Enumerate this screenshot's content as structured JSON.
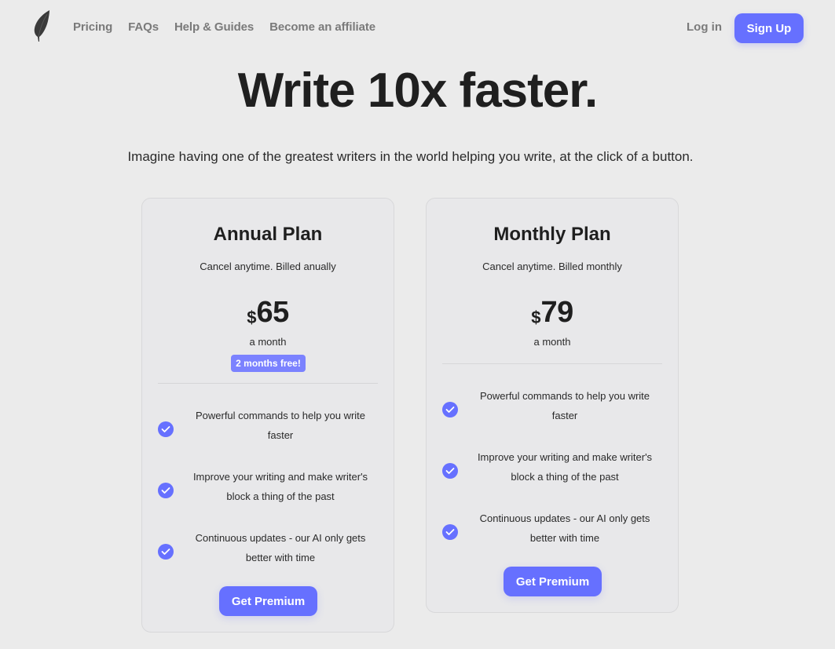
{
  "nav": {
    "logo": "feather-icon",
    "links": [
      "Pricing",
      "FAQs",
      "Help & Guides",
      "Become an affiliate"
    ],
    "login_label": "Log in",
    "signup_label": "Sign Up"
  },
  "hero": {
    "title": "Write 10x faster.",
    "subtitle": "Imagine having one of the greatest writers in the world helping you write, at the click of a button."
  },
  "colors": {
    "accent": "#6670ff",
    "badge": "#7b82ff",
    "background": "#ebebeb",
    "card": "#e8e8ea"
  },
  "plans": [
    {
      "title": "Annual Plan",
      "description": "Cancel anytime. Billed anually",
      "currency": "$",
      "price": "65",
      "period": "a month",
      "badge": "2 months free!",
      "features": [
        "Powerful commands to help you write faster",
        "Improve your writing and make writer's block a thing of the past",
        "Continuous updates - our AI only gets better with time"
      ],
      "cta_label": "Get Premium"
    },
    {
      "title": "Monthly Plan",
      "description": "Cancel anytime. Billed monthly",
      "currency": "$",
      "price": "79",
      "period": "a month",
      "features": [
        "Powerful commands to help you write faster",
        "Improve your writing and make writer's block a thing of the past",
        "Continuous updates - our AI only gets better with time"
      ],
      "cta_label": "Get Premium"
    }
  ]
}
